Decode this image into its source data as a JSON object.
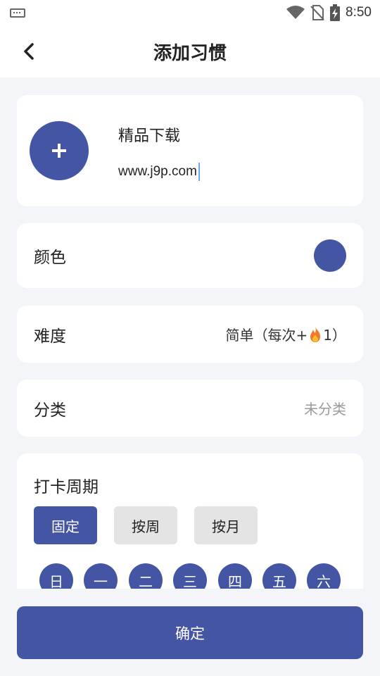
{
  "status_bar": {
    "time": "8:50"
  },
  "header": {
    "title": "添加习惯"
  },
  "habit": {
    "name": "精品下载",
    "description": "www.j9p.com"
  },
  "color_row": {
    "label": "颜色",
    "selected_color": "#4456a3"
  },
  "difficulty_row": {
    "label": "难度",
    "value_prefix": "简单（每次+",
    "value_suffix": "1）"
  },
  "category_row": {
    "label": "分类",
    "value": "未分类"
  },
  "cycle": {
    "title": "打卡周期",
    "options": [
      {
        "label": "固定",
        "selected": true
      },
      {
        "label": "按周",
        "selected": false
      },
      {
        "label": "按月",
        "selected": false
      }
    ],
    "days": [
      "日",
      "一",
      "二",
      "三",
      "四",
      "五",
      "六"
    ]
  },
  "confirm_label": "确定",
  "colors": {
    "accent": "#4456a3",
    "background": "#f3f5f9",
    "muted_button": "#e4e4e4"
  }
}
